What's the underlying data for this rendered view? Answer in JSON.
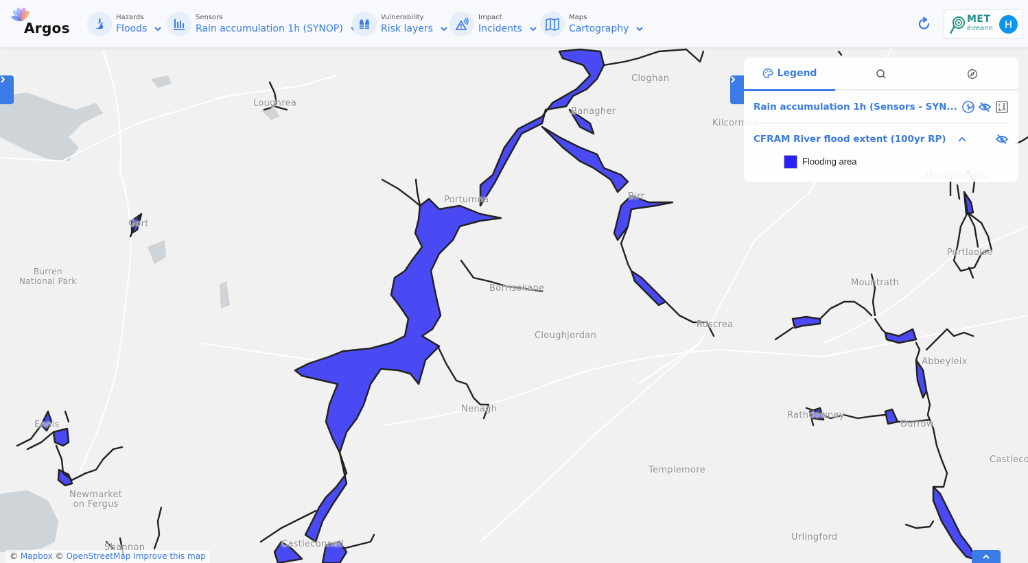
{
  "app": {
    "name": "Argos"
  },
  "nav": [
    {
      "id": "hazards",
      "category": "Hazards",
      "value": "Floods",
      "icon": "flood-wave-icon"
    },
    {
      "id": "sensors",
      "category": "Sensors",
      "value": "Rain accumulation 1h (SYNOP)",
      "icon": "bar-chart-icon"
    },
    {
      "id": "vulnerability",
      "category": "Vulnerability",
      "value": "Risk layers",
      "icon": "life-vest-icon"
    },
    {
      "id": "impact",
      "category": "Impact",
      "value": "Incidents",
      "icon": "warning-signal-icon"
    },
    {
      "id": "maps",
      "category": "Maps",
      "value": "Cartography",
      "icon": "map-icon"
    }
  ],
  "header_right": {
    "refresh_icon": "refresh-icon",
    "org_name_line1": "MET",
    "org_name_line2": "éireann",
    "avatar_initial": "H"
  },
  "legend_panel": {
    "tabs": [
      {
        "label": "Legend",
        "icon": "palette-icon",
        "active": true
      },
      {
        "label": "",
        "icon": "search-icon",
        "active": false
      },
      {
        "label": "",
        "icon": "compass-icon",
        "active": false
      }
    ],
    "layers": [
      {
        "name": "Rain accumulation 1h (Sensors - SYN...",
        "expanded": false,
        "actions": [
          "info-icon",
          "eye-off-icon",
          "sort-numeric-icon"
        ]
      },
      {
        "name": "CFRAM River flood extent (100yr RP)",
        "expanded": true,
        "actions": [
          "eye-off-icon"
        ],
        "legend_items": [
          {
            "label": "Flooding area",
            "color": "#2a22f5"
          }
        ]
      }
    ]
  },
  "map": {
    "flood_fill_color": "#4a4af5",
    "flood_outline_color": "#222222",
    "places": [
      {
        "name": "Loughrea"
      },
      {
        "name": "Gort"
      },
      {
        "name": "Burren\nNational Park"
      },
      {
        "name": "Cloghan"
      },
      {
        "name": "Banagher"
      },
      {
        "name": "Kilcormac"
      },
      {
        "name": "Portumna"
      },
      {
        "name": "Birr"
      },
      {
        "name": "Borrisokane"
      },
      {
        "name": "Cloughjordan"
      },
      {
        "name": "Nenagh"
      },
      {
        "name": "Ennis"
      },
      {
        "name": "Newmarket\non Fergus"
      },
      {
        "name": "Templemore"
      },
      {
        "name": "Urlingford"
      },
      {
        "name": "Shannon"
      },
      {
        "name": "Castleconnell"
      },
      {
        "name": "Mountmellick"
      },
      {
        "name": "Portlaoise"
      },
      {
        "name": "Mountrath"
      },
      {
        "name": "Abbeyleix"
      },
      {
        "name": "Rathdowney"
      },
      {
        "name": "Durrow"
      },
      {
        "name": "Castlecomer"
      },
      {
        "name": "Roscrea"
      }
    ]
  },
  "attribution": {
    "mapbox": "Mapbox",
    "osm": "OpenStreetMap",
    "improve": "Improve this map",
    "copyright": "©"
  }
}
